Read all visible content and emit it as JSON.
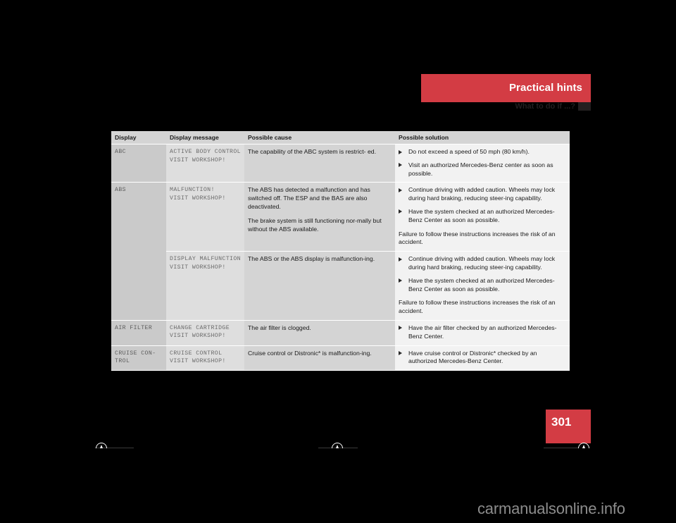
{
  "header": {
    "title": "Practical hints",
    "subtitle": "What to do if ...?",
    "band_color": "#d33c44"
  },
  "table": {
    "columns": [
      "Display",
      "Display message",
      "Possible cause",
      "Possible solution"
    ],
    "rows": [
      {
        "display": "ABC",
        "message": "ACTIVE BODY CONTROL\nVISIT WORKSHOP!",
        "cause": [
          "The capability of the ABC system is restrict-\ned."
        ],
        "solution_bullets": [
          "Do not exceed a speed of 50 mph (80 km/h).",
          "Visit an authorized Mercedes-Benz center as soon as possible."
        ],
        "solution_note": ""
      },
      {
        "display": "ABS",
        "message": "MALFUNCTION!\nVISIT WORKSHOP!",
        "cause": [
          "The ABS has detected a malfunction and has switched off. The ESP and the BAS are also deactivated.",
          "The brake system is still functioning nor-mally but without the ABS available."
        ],
        "solution_bullets": [
          "Continue driving with added caution. Wheels may lock during hard braking, reducing steer-ing capability.",
          "Have the system checked at an authorized Mercedes-Benz Center as soon as possible."
        ],
        "solution_note": "Failure to follow these instructions increases the risk of an accident."
      },
      {
        "display": "",
        "message": "DISPLAY MALFUNCTION\nVISIT WORKSHOP!",
        "cause": [
          "The ABS or the ABS display is malfunction-ing."
        ],
        "solution_bullets": [
          "Continue driving with added caution. Wheels may lock during hard braking, reducing steer-ing capability.",
          "Have the system checked at an authorized Mercedes-Benz Center as soon as possible."
        ],
        "solution_note": "Failure to follow these instructions increases the risk of an accident."
      },
      {
        "display": "AIR FILTER",
        "message": "CHANGE CARTRIDGE\nVISIT WORKSHOP!",
        "cause": [
          "The air filter is clogged."
        ],
        "solution_bullets": [
          "Have the air filter checked by an authorized Mercedes-Benz Center."
        ],
        "solution_note": ""
      },
      {
        "display": "CRUISE CON-\nTROL",
        "message": "CRUISE CONTROL\nVISIT WORKSHOP!",
        "cause": [
          "Cruise control or Distronic* is malfunction-ing."
        ],
        "solution_bullets": [
          "Have cruise control or Distronic* checked by an authorized Mercedes-Benz Center."
        ],
        "solution_note": ""
      }
    ]
  },
  "footer": {
    "page_number": "301",
    "watermark": "carmanualsonline.info"
  }
}
